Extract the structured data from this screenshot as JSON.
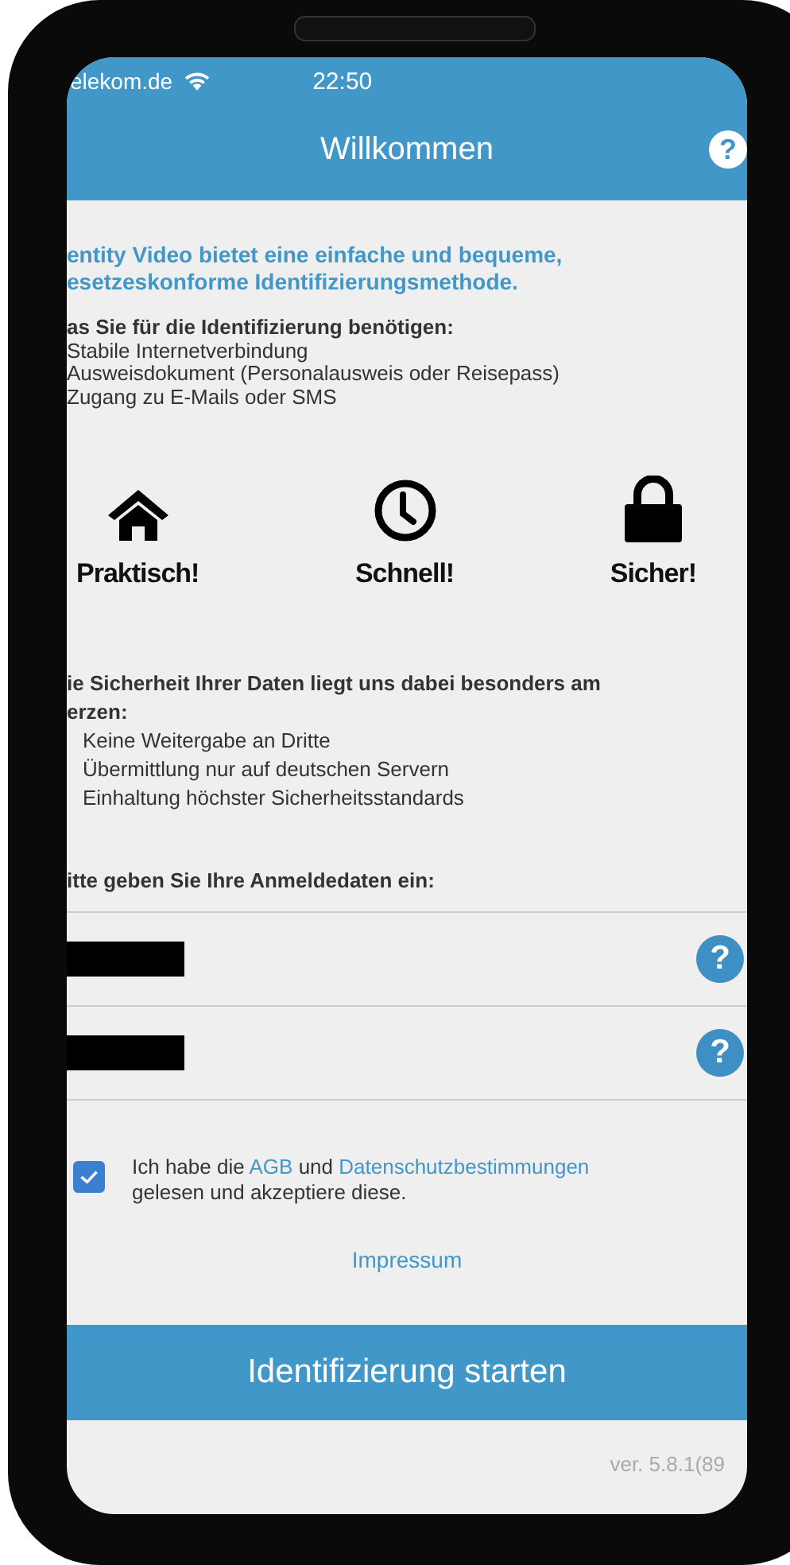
{
  "status_bar": {
    "carrier": "elekom.de",
    "time": "22:50"
  },
  "nav_bar": {
    "title": "Willkommen",
    "help": "?"
  },
  "intro": [
    "entity Video bietet eine einfache und bequeme,",
    "esetzeskonforme Identifizierungsmethode."
  ],
  "requirements": {
    "heading": "as Sie für die Identifizierung benötigen:",
    "items": [
      "Stabile Internetverbindung",
      "Ausweisdokument (Personalausweis oder Reisepass)",
      "Zugang zu E-Mails oder SMS"
    ]
  },
  "features": [
    {
      "kind": "house",
      "label": "Praktisch!"
    },
    {
      "kind": "clock",
      "label": "Schnell!"
    },
    {
      "kind": "lock",
      "label": "Sicher!"
    }
  ],
  "privacy": {
    "heading": [
      "ie Sicherheit Ihrer Daten liegt uns dabei besonders am",
      "erzen:"
    ],
    "items": [
      "Keine Weitergabe an Dritte",
      "Übermittlung nur auf deutschen Servern",
      "Einhaltung höchster Sicherheitsstandards"
    ]
  },
  "login": {
    "heading": "itte geben Sie Ihre Anmeldedaten ein:",
    "fields": [
      {
        "redacted": true,
        "help": "?"
      },
      {
        "redacted": true,
        "help": "?"
      }
    ]
  },
  "consent": {
    "checked": true,
    "lines": [
      [
        {
          "kind": "text",
          "text": "Ich habe die "
        },
        {
          "kind": "link",
          "text": "AGB"
        },
        {
          "kind": "text",
          "text": " und "
        },
        {
          "kind": "link",
          "text": "Datenschutzbestimmungen"
        }
      ],
      [
        {
          "kind": "text",
          "text": "gelesen und akzeptiere diese."
        }
      ]
    ]
  },
  "impressum": "Impressum",
  "start_button": "Identifizierung starten",
  "version": "ver. 5.8.1(89"
}
